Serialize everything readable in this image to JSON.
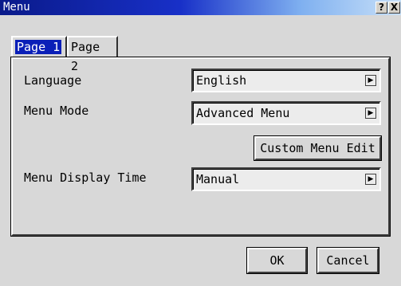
{
  "window": {
    "title": "Menu",
    "help_glyph": "?",
    "close_glyph": "X"
  },
  "tabs": [
    {
      "label": "Page 1",
      "selected": true
    },
    {
      "label": "Page 2",
      "selected": false
    }
  ],
  "settings": {
    "language": {
      "label": "Language",
      "value": "English"
    },
    "menu_mode": {
      "label": "Menu Mode",
      "value": "Advanced Menu"
    },
    "custom_menu_edit_label": "Custom Menu Edit",
    "menu_display_time": {
      "label": "Menu Display Time",
      "value": "Manual"
    }
  },
  "dropdown_arrow_glyph": "▶",
  "footer": {
    "ok_label": "OK",
    "cancel_label": "Cancel"
  },
  "colors": {
    "tab_selected_bg": "#0a1fb8",
    "titlebar_start": "#0a1a8a",
    "titlebar_end": "#c8e0f8",
    "window_bg": "#d8d8d8"
  }
}
